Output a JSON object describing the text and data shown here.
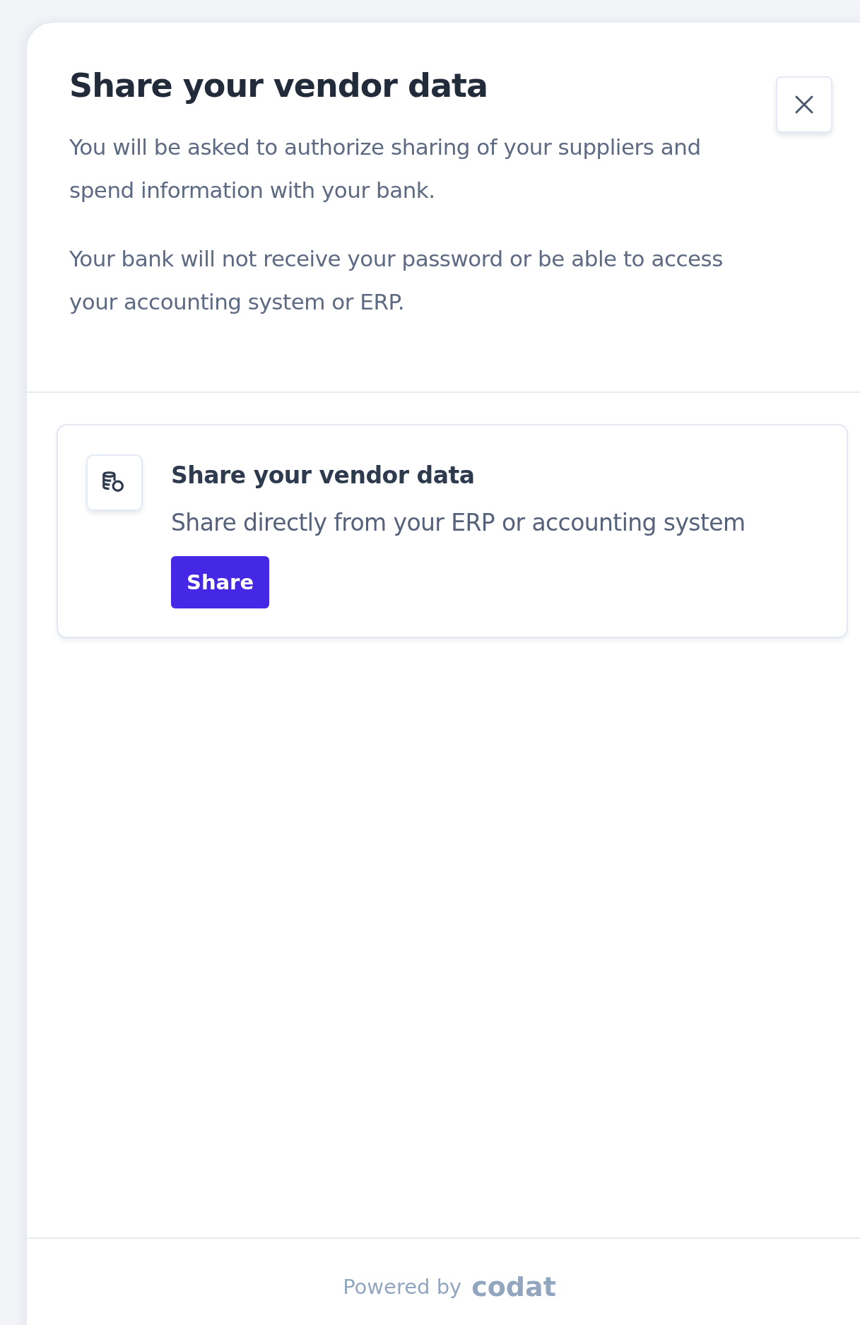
{
  "dialog": {
    "title": "Share your vendor data",
    "paragraphs": [
      "You will be asked to authorize sharing of your suppliers and spend information with your bank.",
      "Your bank will not receive your password or be able to access your accounting system or ERP."
    ]
  },
  "option": {
    "title": "Share your vendor data",
    "description": "Share directly from your ERP or accounting system",
    "button": "Share"
  },
  "footer": {
    "prefix": "Powered by",
    "brand": "codat"
  }
}
